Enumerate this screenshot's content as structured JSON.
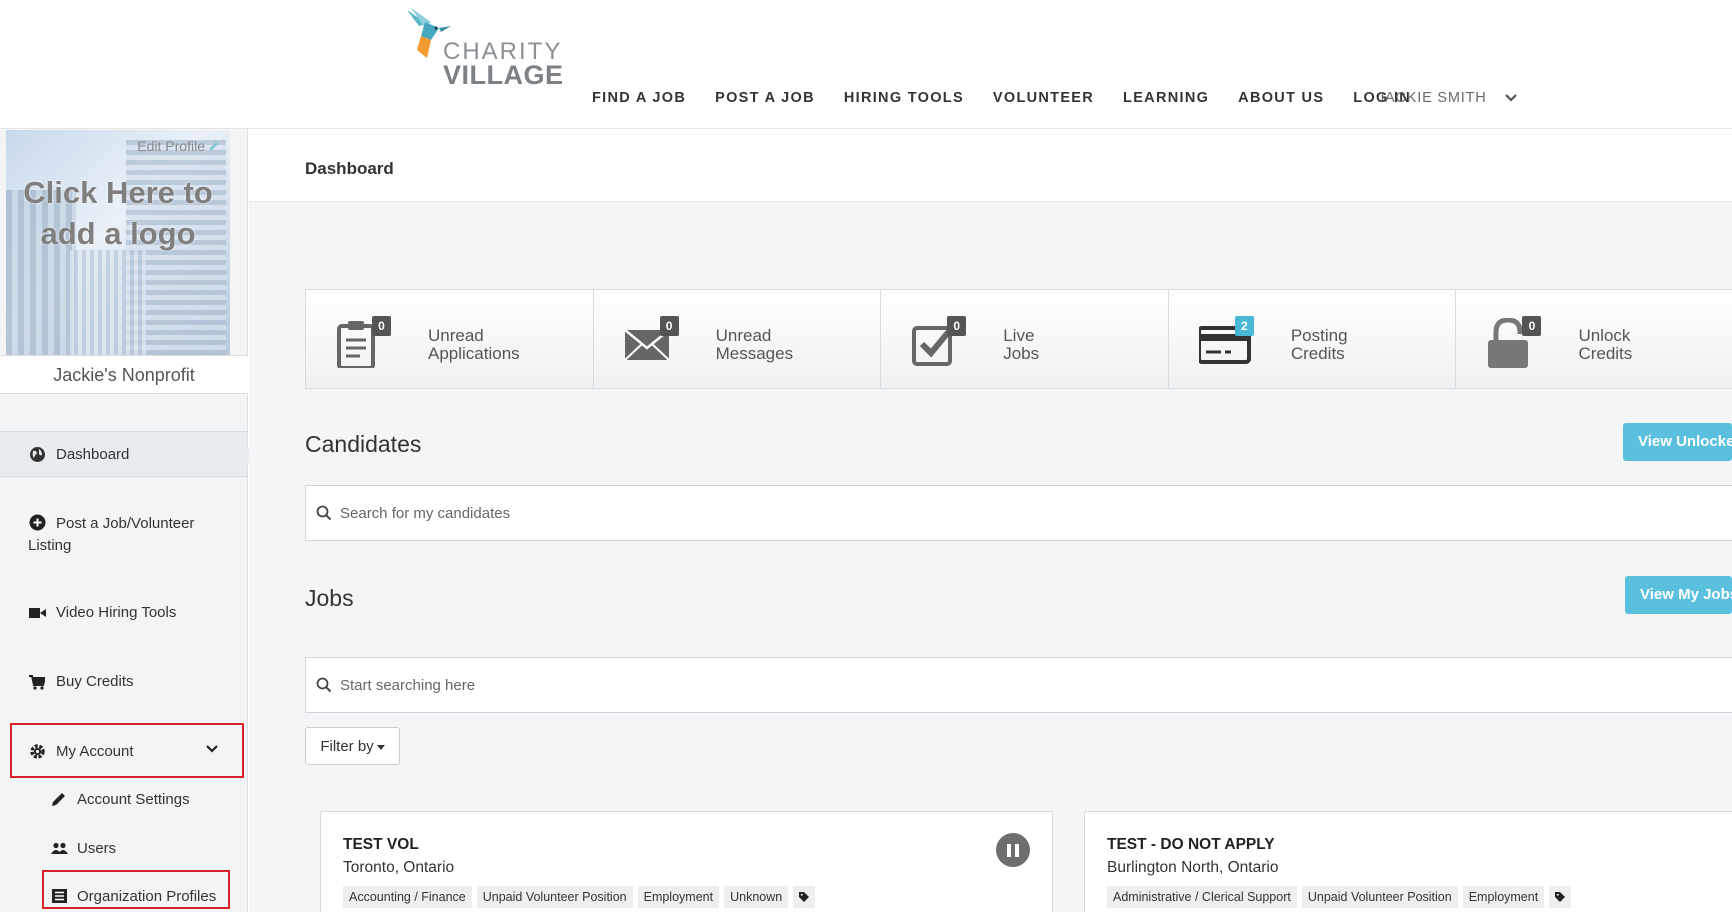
{
  "header": {
    "logo": {
      "line1": "CHARITY",
      "line2": "VILLAGE"
    },
    "nav": [
      "FIND A JOB",
      "POST A JOB",
      "HIRING TOOLS",
      "VOLUNTEER",
      "LEARNING",
      "ABOUT US",
      "LOG IN"
    ],
    "user_name": "JACKIE SMITH"
  },
  "sidebar": {
    "logo_placeholder_line1": "Click Here to",
    "logo_placeholder_line2": "add a logo",
    "edit_profile": "Edit Profile",
    "org_name": "Jackie's Nonprofit",
    "items": [
      {
        "label": "Dashboard",
        "icon": "globe-icon"
      },
      {
        "label": "Post a Job/Volunteer Listing",
        "icon": "plus-circle-icon"
      },
      {
        "label": "Video Hiring Tools",
        "icon": "video-camera-icon"
      },
      {
        "label": "Buy Credits",
        "icon": "cart-icon"
      },
      {
        "label": "My Account",
        "icon": "gear-icon"
      }
    ],
    "sub_items": [
      {
        "label": "Account Settings",
        "icon": "pencil-icon"
      },
      {
        "label": "Users",
        "icon": "users-icon"
      },
      {
        "label": "Organization Profiles",
        "icon": "list-icon"
      }
    ]
  },
  "main": {
    "page_title": "Dashboard",
    "stats": [
      {
        "count": "0",
        "line1": "Unread",
        "line2": "Applications",
        "icon": "clipboard-icon"
      },
      {
        "count": "0",
        "line1": "Unread",
        "line2": "Messages",
        "icon": "envelope-icon"
      },
      {
        "count": "0",
        "line1": "Live",
        "line2": "Jobs",
        "icon": "checkbox-icon"
      },
      {
        "count": "2",
        "line1": "Posting",
        "line2": "Credits",
        "icon": "credit-card-icon"
      },
      {
        "count": "0",
        "line1": "Unlock",
        "line2": "Credits",
        "icon": "lock-icon"
      }
    ],
    "candidates": {
      "title": "Candidates",
      "button": "View Unlocked",
      "search_placeholder": "Search for my candidates"
    },
    "jobs": {
      "title": "Jobs",
      "button": "View My Jobs",
      "search_placeholder": "Start searching here",
      "filter_label": "Filter by",
      "cards": [
        {
          "title": "TEST VOL",
          "location": "Toronto, Ontario",
          "tags": [
            "Accounting / Finance",
            "Unpaid Volunteer Position",
            "Employment",
            "Unknown"
          ]
        },
        {
          "title": "TEST - DO NOT APPLY",
          "location": "Burlington North, Ontario",
          "tags": [
            "Administrative / Clerical Support",
            "Unpaid Volunteer Position",
            "Employment"
          ]
        }
      ]
    }
  }
}
